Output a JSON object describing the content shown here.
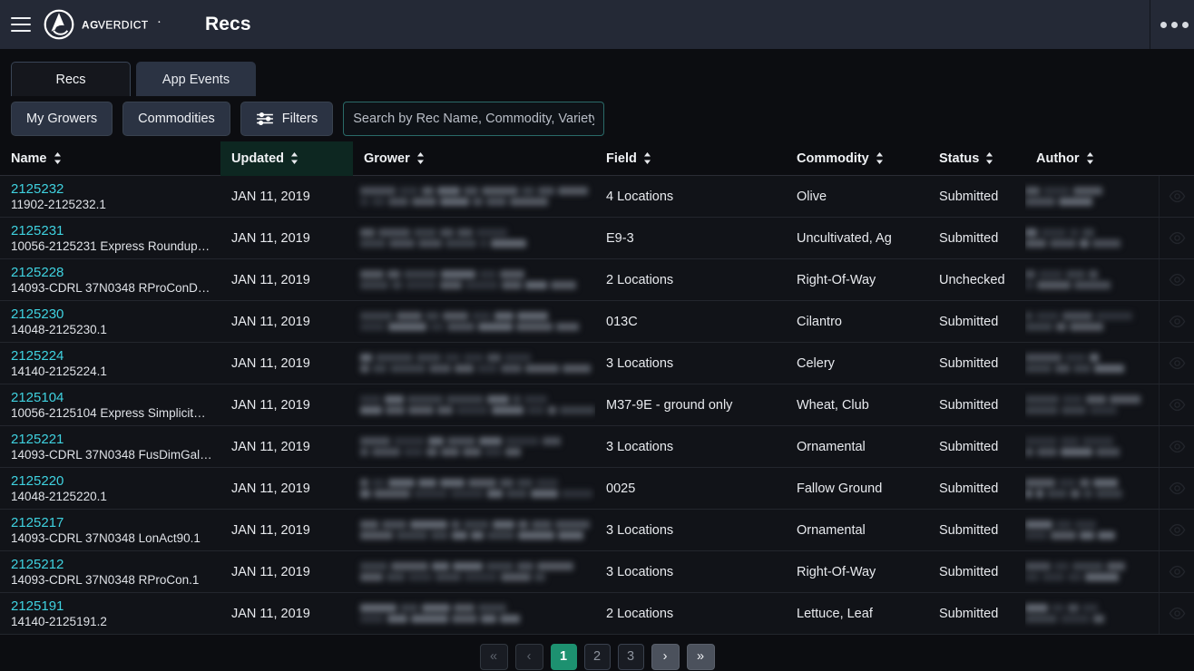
{
  "appbar": {
    "menu_icon": "hamburger-icon",
    "brand_text": "AGVERDICT",
    "brand_mark": "agverdict-logo-icon",
    "title": "Recs",
    "overflow_icon": "more-options-icon"
  },
  "tabs": [
    {
      "label": "Recs",
      "active": true
    },
    {
      "label": "App Events",
      "active": false
    }
  ],
  "filterbar": {
    "my_growers_label": "My Growers",
    "commodities_label": "Commodities",
    "filters_label": "Filters",
    "filters_icon": "sliders-icon",
    "search_placeholder": "Search by Rec Name, Commodity, Variety, Grower",
    "search_value": ""
  },
  "table": {
    "columns": [
      {
        "key": "name",
        "label": "Name",
        "sorted": false
      },
      {
        "key": "updated",
        "label": "Updated",
        "sorted": true
      },
      {
        "key": "grower",
        "label": "Grower",
        "sorted": false
      },
      {
        "key": "field",
        "label": "Field",
        "sorted": false
      },
      {
        "key": "commodity",
        "label": "Commodity",
        "sorted": false
      },
      {
        "key": "status",
        "label": "Status",
        "sorted": false
      },
      {
        "key": "author",
        "label": "Author",
        "sorted": false
      }
    ],
    "row_action_icon": "eye-icon",
    "rows": [
      {
        "name": "2125232",
        "sub": "11902-2125232.1",
        "updated": "JAN 11, 2019",
        "grower": "",
        "field": "4 Locations",
        "commodity": "Olive",
        "status": "Submitted",
        "author": ""
      },
      {
        "name": "2125231",
        "sub": "10056-2125231 Express Roundup…",
        "updated": "JAN 11, 2019",
        "grower": "",
        "field": "E9-3",
        "commodity": "Uncultivated, Ag",
        "status": "Submitted",
        "author": ""
      },
      {
        "name": "2125228",
        "sub": "14093-CDRL 37N0348 RProConD…",
        "updated": "JAN 11, 2019",
        "grower": "",
        "field": "2 Locations",
        "commodity": "Right-Of-Way",
        "status": "Unchecked",
        "author": ""
      },
      {
        "name": "2125230",
        "sub": "14048-2125230.1",
        "updated": "JAN 11, 2019",
        "grower": "",
        "field": "013C",
        "commodity": "Cilantro",
        "status": "Submitted",
        "author": ""
      },
      {
        "name": "2125224",
        "sub": "14140-2125224.1",
        "updated": "JAN 11, 2019",
        "grower": "",
        "field": "3 Locations",
        "commodity": "Celery",
        "status": "Submitted",
        "author": ""
      },
      {
        "name": "2125104",
        "sub": "10056-2125104 Express Simplicit…",
        "updated": "JAN 11, 2019",
        "grower": "",
        "field": "M37-9E - ground only",
        "commodity": "Wheat, Club",
        "status": "Submitted",
        "author": ""
      },
      {
        "name": "2125221",
        "sub": "14093-CDRL 37N0348 FusDimGal…",
        "updated": "JAN 11, 2019",
        "grower": "",
        "field": "3 Locations",
        "commodity": "Ornamental",
        "status": "Submitted",
        "author": ""
      },
      {
        "name": "2125220",
        "sub": "14048-2125220.1",
        "updated": "JAN 11, 2019",
        "grower": "",
        "field": "0025",
        "commodity": "Fallow Ground",
        "status": "Submitted",
        "author": ""
      },
      {
        "name": "2125217",
        "sub": "14093-CDRL 37N0348 LonAct90.1",
        "updated": "JAN 11, 2019",
        "grower": "",
        "field": "3 Locations",
        "commodity": "Ornamental",
        "status": "Submitted",
        "author": ""
      },
      {
        "name": "2125212",
        "sub": "14093-CDRL 37N0348 RProCon.1",
        "updated": "JAN 11, 2019",
        "grower": "",
        "field": "3 Locations",
        "commodity": "Right-Of-Way",
        "status": "Submitted",
        "author": ""
      },
      {
        "name": "2125191",
        "sub": "14140-2125191.2",
        "updated": "JAN 11, 2019",
        "grower": "",
        "field": "2 Locations",
        "commodity": "Lettuce, Leaf",
        "status": "Submitted",
        "author": ""
      }
    ]
  },
  "pagination": {
    "first_label": "«",
    "prev_label": "‹",
    "next_label": "›",
    "last_label": "»",
    "pages": [
      "1",
      "2",
      "3"
    ],
    "current_page": "1"
  },
  "colors": {
    "accent_teal": "#3fd2e0",
    "active_page": "#1d9170",
    "sorted_header_bg": "#0d2721",
    "appbar_bg": "#242936",
    "page_bg": "#0c0d11"
  }
}
